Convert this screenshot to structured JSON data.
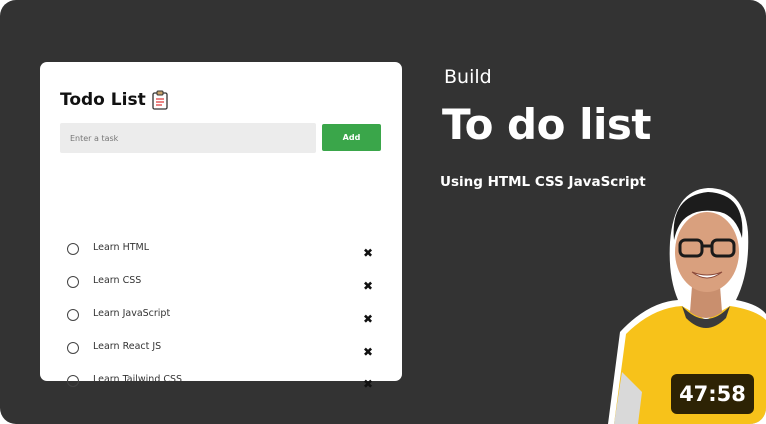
{
  "todo_card": {
    "title": "Todo List",
    "title_icon": "clipboard-icon",
    "input": {
      "placeholder": "Enter a task",
      "value": ""
    },
    "add_label": "Add",
    "items": [
      {
        "label": "Learn HTML",
        "checked": false
      },
      {
        "label": "Learn CSS",
        "checked": false
      },
      {
        "label": "Learn JavaScript",
        "checked": false
      },
      {
        "label": "Learn React JS",
        "checked": false
      },
      {
        "label": "Learn Tailwind CSS",
        "checked": false
      }
    ],
    "delete_glyph": "✖"
  },
  "headline": {
    "build": "Build",
    "title": "To do list",
    "subtitle": "Using HTML CSS JavaScript"
  },
  "video": {
    "duration": "47:58"
  },
  "colors": {
    "background": "#333333",
    "card": "#ffffff",
    "add_button": "#3aa64a",
    "shirt": "#f7c21a"
  }
}
